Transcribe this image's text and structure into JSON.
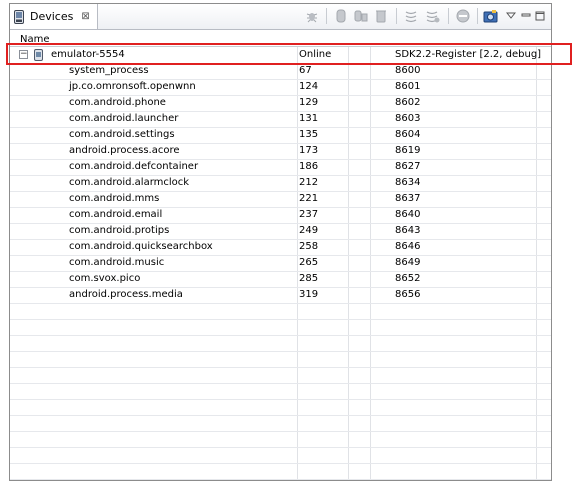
{
  "tab": {
    "title": "Devices",
    "close": "⊠"
  },
  "table": {
    "column_name": "Name",
    "device": {
      "expander": "−",
      "name": "emulator-5554",
      "state": "Online",
      "target": "SDK2.2-Register [2.2, debug]"
    },
    "processes": [
      {
        "name": "system_process",
        "pid": "67",
        "port": "8600"
      },
      {
        "name": "jp.co.omronsoft.openwnn",
        "pid": "124",
        "port": "8601"
      },
      {
        "name": "com.android.phone",
        "pid": "129",
        "port": "8602"
      },
      {
        "name": "com.android.launcher",
        "pid": "131",
        "port": "8603"
      },
      {
        "name": "com.android.settings",
        "pid": "135",
        "port": "8604"
      },
      {
        "name": "android.process.acore",
        "pid": "173",
        "port": "8619"
      },
      {
        "name": "com.android.defcontainer",
        "pid": "186",
        "port": "8627"
      },
      {
        "name": "com.android.alarmclock",
        "pid": "212",
        "port": "8634"
      },
      {
        "name": "com.android.mms",
        "pid": "221",
        "port": "8637"
      },
      {
        "name": "com.android.email",
        "pid": "237",
        "port": "8640"
      },
      {
        "name": "com.android.protips",
        "pid": "249",
        "port": "8643"
      },
      {
        "name": "com.android.quicksearchbox",
        "pid": "258",
        "port": "8646"
      },
      {
        "name": "com.android.music",
        "pid": "265",
        "port": "8649"
      },
      {
        "name": "com.svox.pico",
        "pid": "285",
        "port": "8652"
      },
      {
        "name": "android.process.media",
        "pid": "319",
        "port": "8656"
      }
    ]
  },
  "toolbar": {
    "icons": [
      "debug-bug-icon",
      "update-heap-icon",
      "dump-hprof-icon",
      "cause-gc-icon",
      "update-threads-icon",
      "start-method-profiling-icon",
      "stop-process-icon",
      "screen-capture-icon",
      "view-menu-icon",
      "minimize-icon",
      "maximize-icon"
    ]
  },
  "colors": {
    "highlight": "#e02020",
    "border": "#8c8c8c"
  }
}
